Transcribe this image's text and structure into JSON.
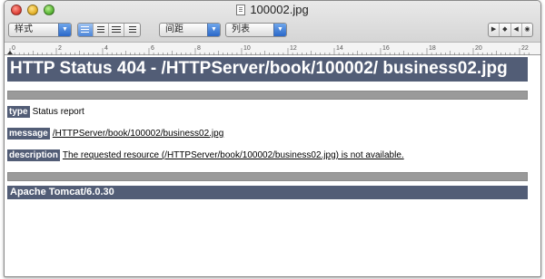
{
  "window": {
    "title": "100002.jpg"
  },
  "toolbar": {
    "style_popup": "样式",
    "spacing_popup": "间距",
    "list_popup": "列表",
    "nav_buttons": [
      "▶",
      "◆",
      "◀",
      "◉"
    ]
  },
  "ruler": {
    "labels": [
      "0",
      "2",
      "4",
      "6",
      "8",
      "10",
      "12",
      "14",
      "16",
      "18",
      "20",
      "22"
    ]
  },
  "page": {
    "heading": "HTTP Status 404 - /HTTPServer/book/100002/ business02.jpg",
    "type_label": "type",
    "type_value": "Status report",
    "message_label": "message",
    "message_value": "/HTTPServer/book/100002/business02.jpg",
    "description_label": "description",
    "description_value": "The requested resource (/HTTPServer/book/100002/business02.jpg) is not available.",
    "footer": "Apache Tomcat/6.0.30"
  },
  "colors": {
    "tomcat_bar": "#525d76",
    "divider_grey": "#9a9a9a"
  }
}
